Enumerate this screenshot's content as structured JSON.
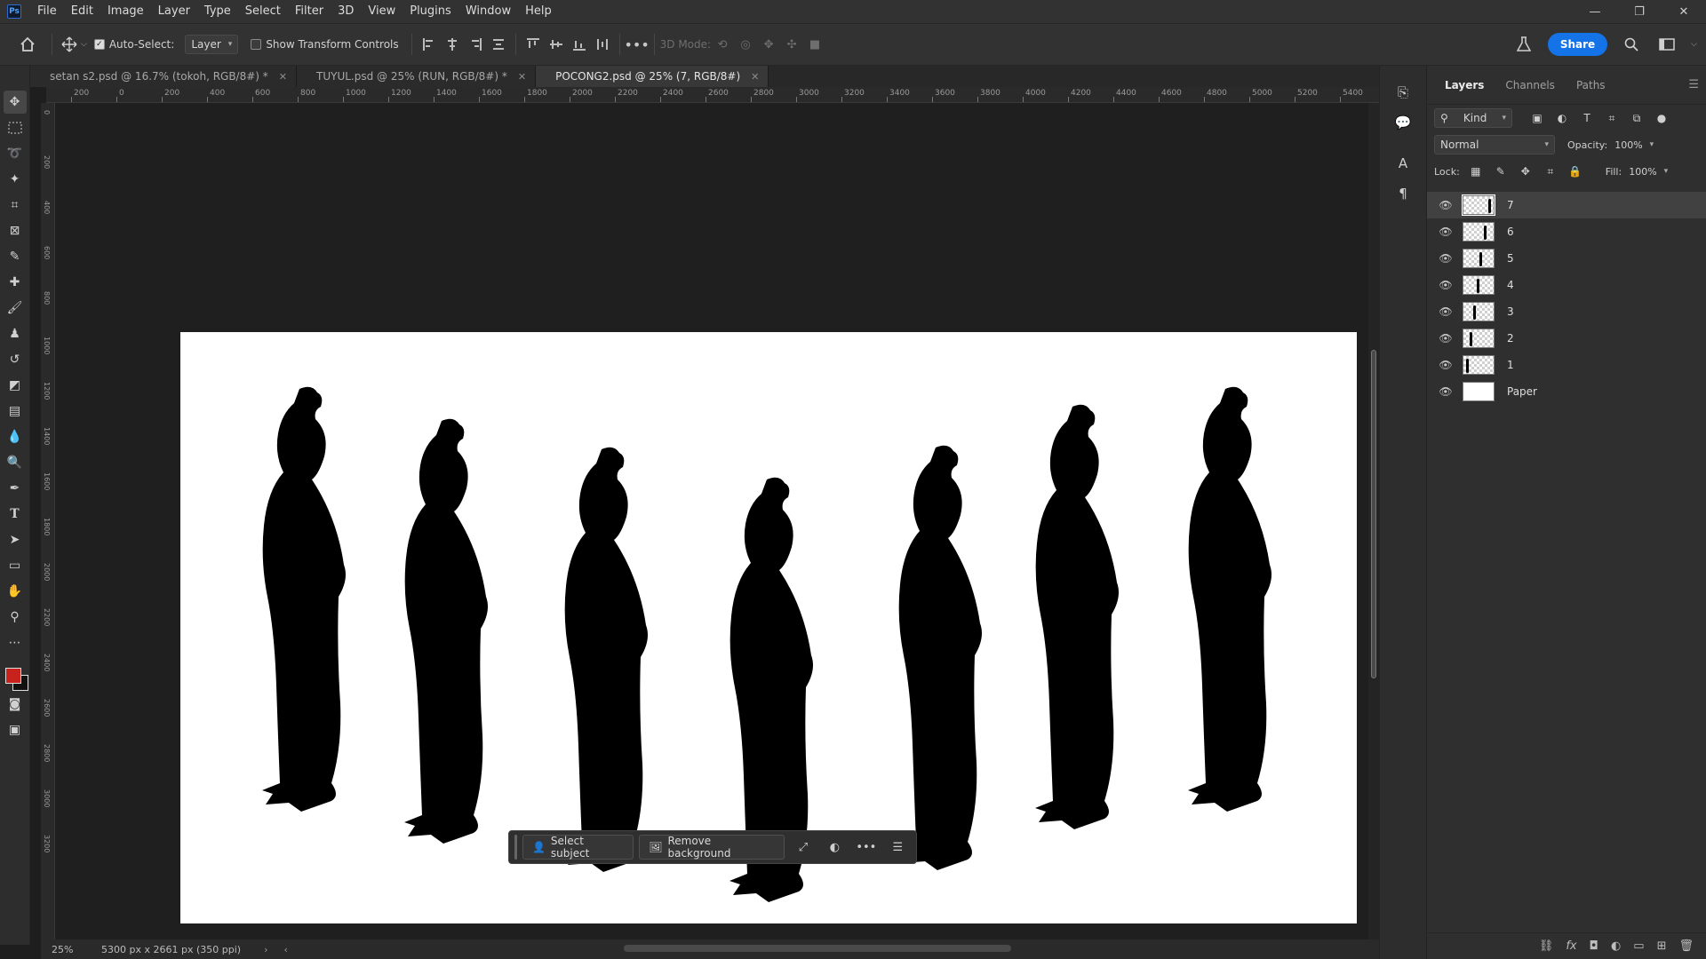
{
  "app": {
    "logo": "Ps"
  },
  "menu": [
    "File",
    "Edit",
    "Image",
    "Layer",
    "Type",
    "Select",
    "Filter",
    "3D",
    "View",
    "Plugins",
    "Window",
    "Help"
  ],
  "window_controls": {
    "minimize": "—",
    "restore": "❐",
    "close": "✕"
  },
  "options": {
    "auto_select_label": "Auto-Select:",
    "auto_select_checked": true,
    "target_value": "Layer",
    "show_transform_label": "Show Transform Controls",
    "mode_3d_label": "3D Mode:",
    "share_label": "Share"
  },
  "tabs": [
    {
      "label": "setan s2.psd @ 16.7% (tokoh, RGB/8#) *",
      "active": false
    },
    {
      "label": "TUYUL.psd @ 25% (RUN, RGB/8#) *",
      "active": false
    },
    {
      "label": "POCONG2.psd @ 25% (7, RGB/8#)",
      "active": true
    }
  ],
  "ruler": {
    "h_labels": [
      "200",
      "0",
      "200",
      "400",
      "600",
      "800",
      "1000",
      "1200",
      "1400",
      "1600",
      "1800",
      "2000",
      "2200",
      "2400",
      "2600",
      "2800",
      "3000",
      "3200",
      "3400",
      "3600",
      "3800",
      "4000",
      "4200",
      "4400",
      "4600",
      "4800",
      "5000",
      "5200",
      "5400"
    ],
    "v_labels": [
      "0",
      "200",
      "400",
      "600",
      "800",
      "1000",
      "1200",
      "1400",
      "1600",
      "1800",
      "2000",
      "2200",
      "2400",
      "2600",
      "2800",
      "3000",
      "3200"
    ]
  },
  "taskbar": {
    "select_subject": "Select subject",
    "remove_background": "Remove background"
  },
  "status": {
    "zoom": "25%",
    "doc_info": "5300 px x 2661 px (350 ppi)"
  },
  "layers_panel": {
    "tabs": [
      "Layers",
      "Channels",
      "Paths"
    ],
    "filter_kind": "Kind",
    "blend_mode": "Normal",
    "opacity_label": "Opacity:",
    "opacity_value": "100%",
    "lock_label": "Lock:",
    "fill_label": "Fill:",
    "fill_value": "100%",
    "layers": [
      {
        "name": "7",
        "selected": true
      },
      {
        "name": "6",
        "selected": false
      },
      {
        "name": "5",
        "selected": false
      },
      {
        "name": "4",
        "selected": false
      },
      {
        "name": "3",
        "selected": false
      },
      {
        "name": "2",
        "selected": false
      },
      {
        "name": "1",
        "selected": false
      },
      {
        "name": "Paper",
        "selected": false
      }
    ]
  },
  "colors": {
    "foreground": "#c8221c",
    "background": "#111111",
    "accent": "#1473e6"
  }
}
